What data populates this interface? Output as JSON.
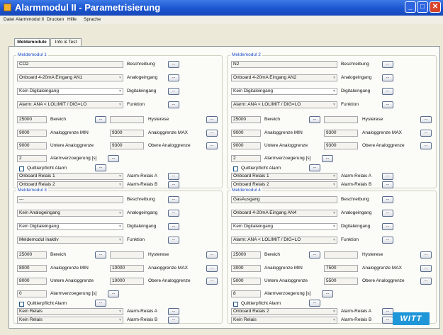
{
  "window": {
    "title": "Alarmmodul II - Parametrisierung"
  },
  "menu": [
    "Datei",
    "Alarmmodul II",
    "Drucken",
    "Hilfe",
    "Sprache"
  ],
  "tabs": [
    "Meldemodule",
    "Info & Test"
  ],
  "labels": {
    "beschreibung": "Beschreibung",
    "analogeingang": "Analogeingang",
    "digitaleingang": "Digitaleingang",
    "funktion": "Funktion",
    "bereich": "Bereich",
    "hysterese": "Hysterese",
    "min": "Analoggrenze MIN",
    "max": "Analoggrenze MAX",
    "untere": "Untere Analoggrenze",
    "obere": "Obere Analoggrenze",
    "verz": "Alarmverzoegerung [s]",
    "quit": "Quittierpflicht Alarm",
    "relaisA": "Alarm-Relais A",
    "relaisB": "Alarm-Relais B",
    "btn": "..."
  },
  "modules": [
    {
      "title": "Meldemodul 1",
      "beschreibung": "CO2",
      "analog": "Onboard 4-20mA Eingang AN1",
      "digital": "Kein Digitaleingang",
      "funktion": "Alarm: ANA < LOLIMIT / DIG=LO",
      "bereich": "25000",
      "hysterese": "",
      "min": "9000",
      "max": "9300",
      "untere": "9000",
      "obere": "9300",
      "verz": "2",
      "relaisA": "Onboard Relais 1",
      "relaisB": "Onboard Relais 2"
    },
    {
      "title": "Meldemodul 2",
      "beschreibung": "N2",
      "analog": "Onboard 4-20mA Eingang AN2",
      "digital": "Kein Digitaleingang",
      "funktion": "Alarm: ANA < LOLIMIT / DIG=LO",
      "bereich": "25000",
      "hysterese": "",
      "min": "9000",
      "max": "9300",
      "untere": "9000",
      "obere": "9300",
      "verz": "2",
      "relaisA": "Onboard Relais 1",
      "relaisB": "Onboard Relais 2"
    },
    {
      "title": "Meldemodul 3",
      "beschreibung": "---",
      "analog": "Kein Analogeingang",
      "digital": "Kein Digitaleingang",
      "funktion": "Meldemodul inaktiv",
      "bereich": "25000",
      "hysterese": "",
      "min": "8000",
      "max": "10000",
      "untere": "8000",
      "obere": "10000",
      "verz": "0",
      "relaisA": "Kein Relais",
      "relaisB": "Kein Relais"
    },
    {
      "title": "Meldemodul 4",
      "beschreibung": "GasAusgang",
      "analog": "Onboard 4-20mA Eingang AN4",
      "digital": "Kein Digitaleingang",
      "funktion": "Alarm: ANA < LOLIMIT / DIG=LO",
      "bereich": "25000",
      "hysterese": "",
      "min": "3000",
      "max": "7500",
      "untere": "5000",
      "obere": "5500",
      "verz": "8",
      "relaisA": "Onboard Relais 2",
      "relaisB": "Kein Relais"
    }
  ],
  "logo": "WITT"
}
